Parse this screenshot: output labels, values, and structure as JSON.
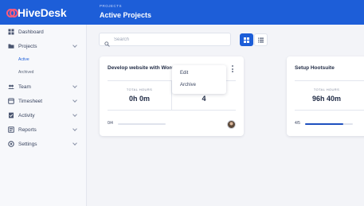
{
  "app": {
    "logo_text": "HiveDesk"
  },
  "header": {
    "breadcrumb": "PROJECTS",
    "title": "Active Projects"
  },
  "sidebar": {
    "items": [
      {
        "label": "Dashboard",
        "icon": "grid-icon",
        "has_chevron": false
      },
      {
        "label": "Projects",
        "icon": "folder-icon",
        "has_chevron": true
      },
      {
        "label": "Team",
        "icon": "users-icon",
        "has_chevron": true
      },
      {
        "label": "Timesheet",
        "icon": "timesheet-icon",
        "has_chevron": true
      },
      {
        "label": "Activity",
        "icon": "activity-icon",
        "has_chevron": true
      },
      {
        "label": "Reports",
        "icon": "reports-icon",
        "has_chevron": true
      },
      {
        "label": "Settings",
        "icon": "settings-icon",
        "has_chevron": true
      }
    ],
    "projects_sub": [
      {
        "label": "Active",
        "active": true
      },
      {
        "label": "Archived",
        "active": false
      }
    ]
  },
  "search": {
    "placeholder": "Search",
    "value": ""
  },
  "view_toggle": {
    "selected": "grid"
  },
  "projects": [
    {
      "title": "Develop website with Word",
      "total_hours_label": "TOTAL HOURS",
      "total_hours": "0h 0m",
      "second_value": "4",
      "progress_text": "0/4",
      "progress": 0,
      "has_avatar": true
    },
    {
      "title": "Setup Hootsuite",
      "total_hours_label": "TOTAL HOURS",
      "total_hours": "96h 40m",
      "progress_text": "4/5",
      "progress": 0.8
    }
  ],
  "context_menu": {
    "items": [
      "Edit",
      "Archive"
    ]
  },
  "colors": {
    "brand": "#1d5ed8",
    "logo_accent": "#ff5a79",
    "progress": "#1d4fbf"
  }
}
